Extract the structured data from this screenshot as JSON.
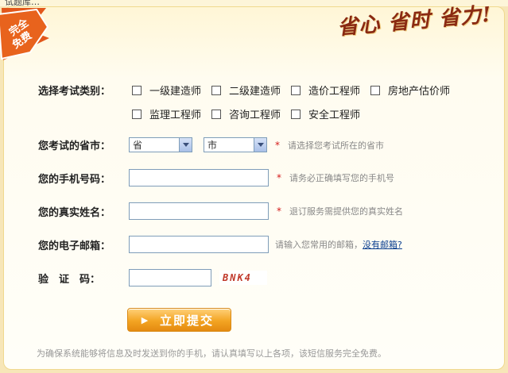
{
  "top_fragment": "试题库…",
  "badge": {
    "line1": "完全",
    "line2": "免费"
  },
  "slogan": [
    "省心",
    "省时",
    "省力!"
  ],
  "category": {
    "label": "选择考试类别：",
    "options_row1": [
      "一级建造师",
      "二级建造师",
      "造价工程师",
      "房地产估价师"
    ],
    "options_row2": [
      "监理工程师",
      "咨询工程师",
      "安全工程师"
    ]
  },
  "province": {
    "label": "您考试的省市：",
    "province_value": "省",
    "city_value": "市",
    "required_mark": "*",
    "hint": "请选择您考试所在的省市"
  },
  "phone": {
    "label": "您的手机号码：",
    "required_mark": "*",
    "hint": "请务必正确填写您的手机号"
  },
  "name": {
    "label": "您的真实姓名：",
    "required_mark": "*",
    "hint": "退订服务需提供您的真实姓名"
  },
  "email": {
    "label": "您的电子邮箱：",
    "hint": "请输入您常用的邮箱，",
    "link": "没有邮箱?"
  },
  "captcha": {
    "label": "验　证　码：",
    "code": "BNK4"
  },
  "submit_label": "立即提交",
  "footer": "为确保系统能够将信息及时发送到你的手机，请认真填写以上各项，该短信服务完全免费。",
  "colors": {
    "accent": "#f3a423",
    "required": "#d51a1a",
    "link": "#0a3e8f",
    "badge": "#e2571b"
  }
}
